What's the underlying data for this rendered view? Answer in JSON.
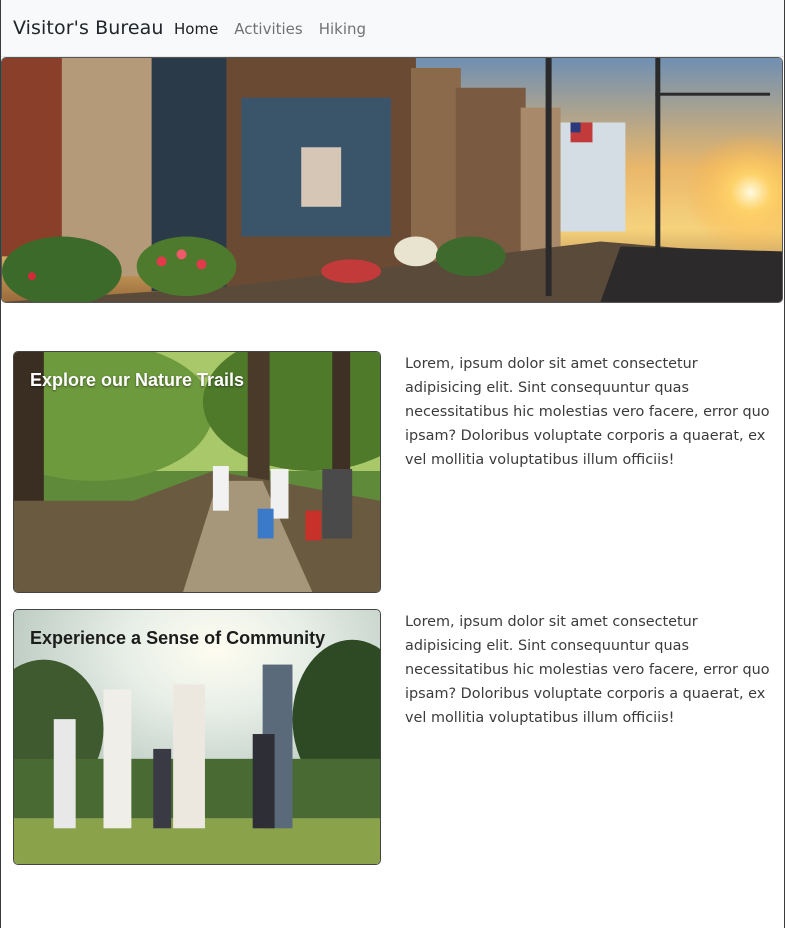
{
  "navbar": {
    "brand": "Visitor's Bureau",
    "links": [
      {
        "label": "Home",
        "active": true
      },
      {
        "label": "Activities",
        "active": false
      },
      {
        "label": "Hiking",
        "active": false
      }
    ]
  },
  "hero": {
    "alt": "Main street storefronts at sunset"
  },
  "features": [
    {
      "title": "Explore our Nature Trails",
      "text": "Lorem, ipsum dolor sit amet consectetur adipisicing elit. Sint consequuntur quas necessitatibus hic molestias vero facere, error quo ipsam? Doloribus voluptate corporis a quaerat, ex vel mollitia voluptatibus illum officiis!"
    },
    {
      "title": "Experience a Sense of Community",
      "text": "Lorem, ipsum dolor sit amet consectetur adipisicing elit. Sint consequuntur quas necessitatibus hic molestias vero facere, error quo ipsam? Doloribus voluptate corporis a quaerat, ex vel mollitia voluptatibus illum officiis!"
    }
  ]
}
